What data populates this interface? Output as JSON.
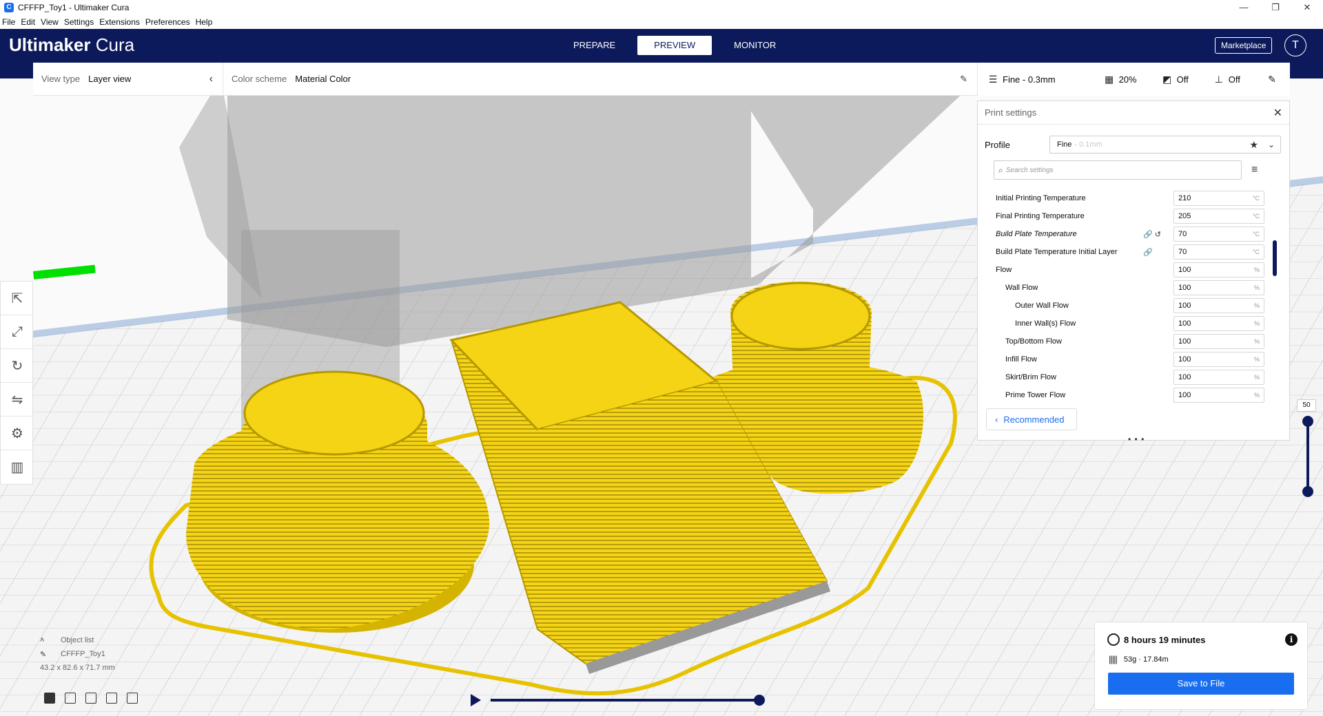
{
  "window": {
    "title": "CFFFP_Toy1 - Ultimaker Cura",
    "controls": [
      "—",
      "❐",
      "✕"
    ]
  },
  "menu": [
    "File",
    "Edit",
    "View",
    "Settings",
    "Extensions",
    "Preferences",
    "Help"
  ],
  "header": {
    "logo_bold": "Ultimaker",
    "logo_light": "Cura",
    "tabs": [
      "PREPARE",
      "PREVIEW",
      "MONITOR"
    ],
    "active_tab": "PREVIEW",
    "marketplace": "Marketplace",
    "account_initial": "T"
  },
  "view_bar": {
    "view_type_label": "View type",
    "view_type_value": "Layer view",
    "color_scheme_label": "Color scheme",
    "color_scheme_value": "Material Color"
  },
  "print_bar": {
    "profile": "Fine - 0.3mm",
    "infill": "20%",
    "support": "Off",
    "adhesion": "Off"
  },
  "print_panel": {
    "title": "Print settings",
    "profile_label": "Profile",
    "profile_name": "Fine",
    "profile_layer": "- 0.1mm",
    "search_placeholder": "Search settings",
    "settings": [
      {
        "name": "Initial Printing Temperature",
        "value": "210",
        "unit": "°C",
        "indent": 0,
        "italic": false,
        "icons": ""
      },
      {
        "name": "Final Printing Temperature",
        "value": "205",
        "unit": "°C",
        "indent": 0,
        "italic": false,
        "icons": ""
      },
      {
        "name": "Build Plate Temperature",
        "value": "70",
        "unit": "°C",
        "indent": 0,
        "italic": true,
        "icons": "🔗 ↺"
      },
      {
        "name": "Build Plate Temperature Initial Layer",
        "value": "70",
        "unit": "°C",
        "indent": 0,
        "italic": false,
        "icons": "🔗"
      },
      {
        "name": "Flow",
        "value": "100",
        "unit": "%",
        "indent": 0,
        "italic": false,
        "icons": ""
      },
      {
        "name": "Wall Flow",
        "value": "100",
        "unit": "%",
        "indent": 1,
        "italic": false,
        "icons": ""
      },
      {
        "name": "Outer Wall Flow",
        "value": "100",
        "unit": "%",
        "indent": 2,
        "italic": false,
        "icons": ""
      },
      {
        "name": "Inner Wall(s) Flow",
        "value": "100",
        "unit": "%",
        "indent": 2,
        "italic": false,
        "icons": ""
      },
      {
        "name": "Top/Bottom Flow",
        "value": "100",
        "unit": "%",
        "indent": 1,
        "italic": false,
        "icons": ""
      },
      {
        "name": "Infill Flow",
        "value": "100",
        "unit": "%",
        "indent": 1,
        "italic": false,
        "icons": ""
      },
      {
        "name": "Skirt/Brim Flow",
        "value": "100",
        "unit": "%",
        "indent": 1,
        "italic": false,
        "icons": ""
      },
      {
        "name": "Prime Tower Flow",
        "value": "100",
        "unit": "%",
        "indent": 1,
        "italic": false,
        "icons": ""
      }
    ],
    "recommended_label": "Recommended"
  },
  "object_list": {
    "title": "Object list",
    "object_name": "CFFFP_Toy1",
    "dimensions": "43.2 x 82.6 x 71.7 mm"
  },
  "layer_slider": {
    "current_layer": "50"
  },
  "job": {
    "time": "8 hours 19 minutes",
    "material": "53g · 17.84m",
    "save_label": "Save to File"
  },
  "colors": {
    "header": "#0c1a5b",
    "accent": "#196ef0",
    "filament": "#f5d415",
    "skirt": "#00e000"
  }
}
